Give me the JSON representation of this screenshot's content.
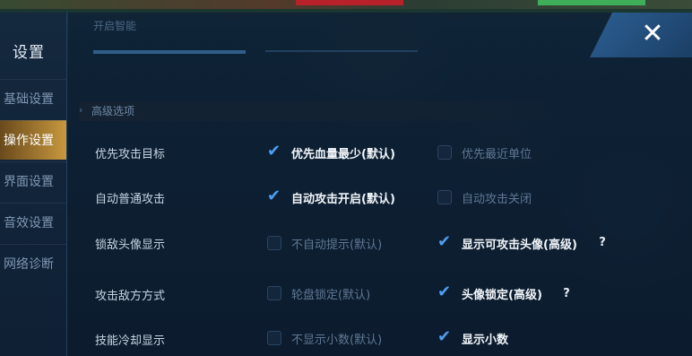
{
  "sidebar": {
    "title": "设置",
    "items": [
      {
        "label": "基础设置",
        "active": false
      },
      {
        "label": "操作设置",
        "active": true
      },
      {
        "label": "界面设置",
        "active": false
      },
      {
        "label": "音效设置",
        "active": false
      },
      {
        "label": "网络诊断",
        "active": false
      }
    ]
  },
  "header": {
    "ghost_tab": "开启智能"
  },
  "close_icon": "close-icon",
  "section": {
    "title": "高级选项"
  },
  "rows": [
    {
      "label": "优先攻击目标",
      "options": [
        {
          "text": "优先血量最少(默认)",
          "checked": true
        },
        {
          "text": "优先最近单位",
          "checked": false
        }
      ],
      "help": ""
    },
    {
      "label": "自动普通攻击",
      "options": [
        {
          "text": "自动攻击开启(默认)",
          "checked": true
        },
        {
          "text": "自动攻击关闭",
          "checked": false
        }
      ],
      "help": ""
    },
    {
      "label": "锁敌头像显示",
      "options": [
        {
          "text": "不自动提示(默认)",
          "checked": false
        },
        {
          "text": "显示可攻击头像(高级)",
          "checked": true
        }
      ],
      "help": "?"
    },
    {
      "label": "攻击敌方方式",
      "options": [
        {
          "text": "轮盘锁定(默认)",
          "checked": false
        },
        {
          "text": "头像锁定(高级)",
          "checked": true
        }
      ],
      "help": "?"
    },
    {
      "label": "技能冷却显示",
      "options": [
        {
          "text": "不显示小数(默认)",
          "checked": false
        },
        {
          "text": "显示小数",
          "checked": true
        }
      ],
      "help": ""
    }
  ],
  "colors": {
    "accent": "#4f9df2",
    "active_tab": "#c8983e"
  }
}
